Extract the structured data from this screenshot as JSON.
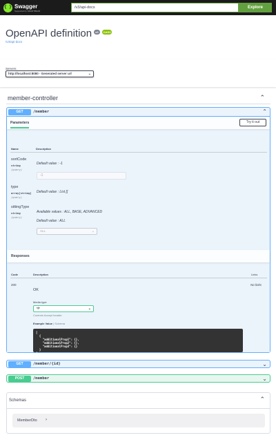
{
  "topbar": {
    "logo_name": "Swagger",
    "logo_sub": "Supported by SMARTBEAR",
    "url_value": "/v3/api-docs",
    "explore_label": "Explore"
  },
  "info": {
    "title": "OpenAPI definition",
    "version": "v0",
    "oas": "OAS3",
    "spec_link": "/v3/api-docs"
  },
  "servers": {
    "label": "Servers",
    "selected": "http://localhost:8080 - Generated server url"
  },
  "tag": {
    "name": "member-controller"
  },
  "operations": [
    {
      "method": "GET",
      "path": "/member",
      "expanded": true,
      "parameters_tab": "Parameters",
      "try_label": "Try it out",
      "col_name": "Name",
      "col_description": "Description",
      "params": [
        {
          "name": "sortCode",
          "type": "string",
          "in": "(query)",
          "default_text": "Default value : -1",
          "input_value": "-1"
        },
        {
          "name": "type",
          "type": "array[string]",
          "in": "(query)",
          "default_text": "Default value : List []"
        },
        {
          "name": "sittingType",
          "type": "string",
          "in": "(query)",
          "available_text": "Available values : ALL, BASE, ADVANCED",
          "default_text": "Default value : ALL",
          "select_value": "ALL"
        }
      ],
      "responses_title": "Responses",
      "resp_col_code": "Code",
      "resp_col_description": "Description",
      "resp_col_links": "Links",
      "responses": [
        {
          "code": "200",
          "description": "OK",
          "links": "No links",
          "media_label": "Media type",
          "media_value": "*/*",
          "media_note": "Controls Accept header.",
          "example_label": "Example Value",
          "schema_label": "Schema",
          "example_code": "[\n  {\n    \"additionalProp1\": {},\n    \"additionalProp2\": {},\n    \"additionalProp3\": {}\n  }\n]"
        }
      ]
    },
    {
      "method": "GET",
      "path": "/member/{id}",
      "expanded": false
    },
    {
      "method": "POST",
      "path": "/member",
      "expanded": false
    }
  ],
  "schemas": {
    "title": "Schemas",
    "models": [
      "MemberDto"
    ]
  }
}
